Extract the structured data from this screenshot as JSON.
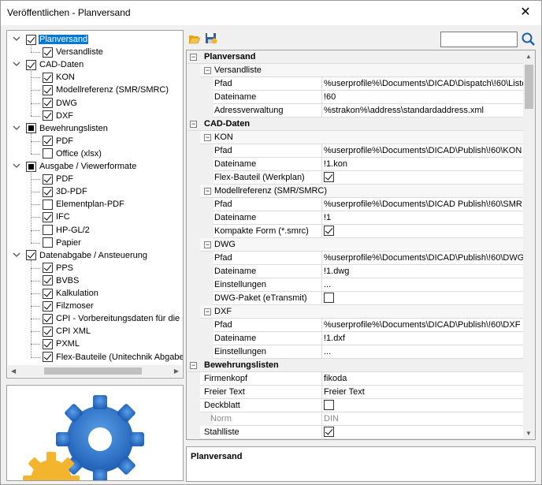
{
  "window": {
    "title": "Veröffentlichen - Planversand",
    "close_glyph": "✕"
  },
  "tree": {
    "nodes": [
      {
        "label": "Planversand",
        "state": "chk",
        "selected": true
      },
      {
        "label": "Versandliste",
        "state": "chk"
      },
      {
        "label": "CAD-Daten",
        "state": "chk"
      },
      {
        "label": "KON",
        "state": "chk"
      },
      {
        "label": "Modellreferenz (SMR/SMRC)",
        "state": "chk"
      },
      {
        "label": "DWG",
        "state": "chk"
      },
      {
        "label": "DXF",
        "state": "chk"
      },
      {
        "label": "Bewehrungslisten",
        "state": "part"
      },
      {
        "label": "PDF",
        "state": "chk"
      },
      {
        "label": "Office (xlsx)",
        "state": "none"
      },
      {
        "label": "Ausgabe / Viewerformate",
        "state": "part"
      },
      {
        "label": "PDF",
        "state": "chk"
      },
      {
        "label": "3D-PDF",
        "state": "chk"
      },
      {
        "label": "Elementplan-PDF",
        "state": "none"
      },
      {
        "label": "IFC",
        "state": "chk"
      },
      {
        "label": "HP-GL/2",
        "state": "none"
      },
      {
        "label": "Papier",
        "state": "none"
      },
      {
        "label": "Datenabgabe / Ansteuerung",
        "state": "chk"
      },
      {
        "label": "PPS",
        "state": "chk"
      },
      {
        "label": "BVBS",
        "state": "chk"
      },
      {
        "label": "Kalkulation",
        "state": "chk"
      },
      {
        "label": "Filzmoser",
        "state": "chk"
      },
      {
        "label": "CPI - Vorbereitungsdaten für die C",
        "state": "chk"
      },
      {
        "label": "CPI XML",
        "state": "chk"
      },
      {
        "label": "PXML",
        "state": "chk"
      },
      {
        "label": "Flex-Bauteile (Unitechnik Abgabe)",
        "state": "chk"
      }
    ]
  },
  "search": {
    "value": ""
  },
  "grid": {
    "rows": [
      {
        "kind": "cat",
        "text": "Planversand"
      },
      {
        "kind": "sub",
        "text": "Versandliste"
      },
      {
        "kind": "prop",
        "name": "Pfad",
        "value": "%userprofile%\\Documents\\DICAD\\Dispatch\\!60\\Liste"
      },
      {
        "kind": "prop",
        "name": "Dateiname",
        "value": "!60"
      },
      {
        "kind": "prop",
        "name": "Adressverwaltung",
        "value": "%strakon%\\address\\standardaddress.xml"
      },
      {
        "kind": "cat",
        "text": "CAD-Daten"
      },
      {
        "kind": "sub",
        "text": "KON"
      },
      {
        "kind": "prop",
        "name": "Pfad",
        "value": "%userprofile%\\Documents\\DICAD\\Publish\\!60\\KON"
      },
      {
        "kind": "prop",
        "name": "Dateiname",
        "value": "!1.kon"
      },
      {
        "kind": "prop",
        "name": "Flex-Bauteil (Werkplan)",
        "check": true
      },
      {
        "kind": "sub",
        "text": "Modellreferenz (SMR/SMRC)"
      },
      {
        "kind": "prop",
        "name": "Pfad",
        "value": "%userprofile%\\Documents\\DICAD Publish\\!60\\SMR"
      },
      {
        "kind": "prop",
        "name": "Dateiname",
        "value": "!1"
      },
      {
        "kind": "prop",
        "name": "Kompakte Form (*.smrc)",
        "check": true
      },
      {
        "kind": "sub",
        "text": "DWG"
      },
      {
        "kind": "prop",
        "name": "Pfad",
        "value": "%userprofile%\\Documents\\DICAD\\Publish\\!60\\DWG"
      },
      {
        "kind": "prop",
        "name": "Dateiname",
        "value": "!1.dwg"
      },
      {
        "kind": "prop",
        "name": "Einstellungen",
        "value": "..."
      },
      {
        "kind": "prop",
        "name": "DWG-Paket (eTransmit)",
        "check": false
      },
      {
        "kind": "sub",
        "text": "DXF"
      },
      {
        "kind": "prop",
        "name": "Pfad",
        "value": "%userprofile%\\Documents\\DICAD\\Publish\\!60\\DXF"
      },
      {
        "kind": "prop",
        "name": "Dateiname",
        "value": "!1.dxf"
      },
      {
        "kind": "prop",
        "name": "Einstellungen",
        "value": "..."
      },
      {
        "kind": "cat",
        "text": "Bewehrungslisten"
      },
      {
        "kind": "prop0",
        "name": "Firmenkopf",
        "value": "fikoda"
      },
      {
        "kind": "prop0",
        "name": "Freier Text",
        "value": "Freier Text"
      },
      {
        "kind": "prop0",
        "name": "Deckblatt",
        "check": false
      },
      {
        "kind": "prop",
        "name": "Norm",
        "value": "DIN",
        "disabled": true
      },
      {
        "kind": "prop0",
        "name": "Stahlliste",
        "check": true
      }
    ]
  },
  "description": {
    "title": "Planversand"
  }
}
